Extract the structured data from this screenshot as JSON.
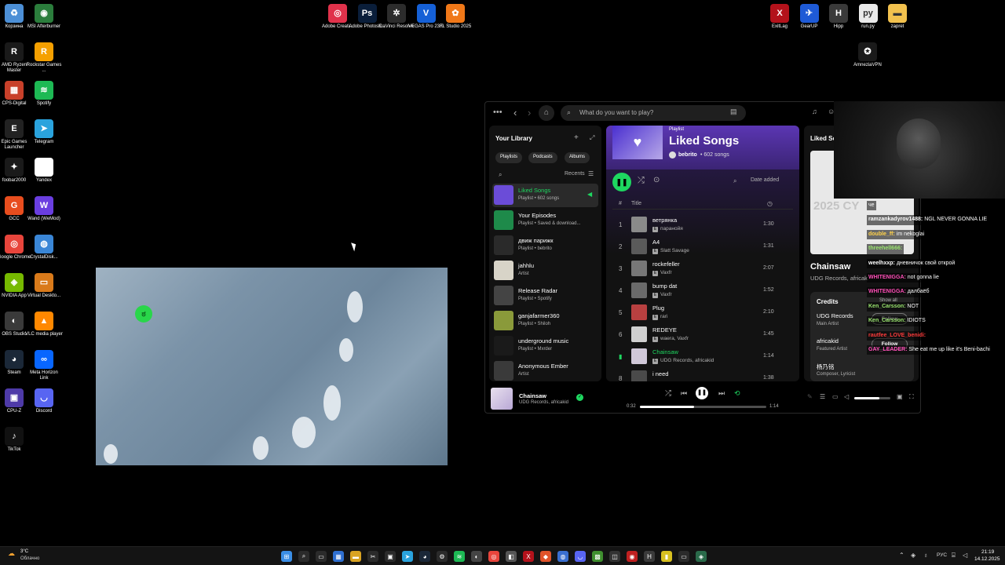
{
  "desktop": {
    "icons_left": [
      {
        "label": "Корзина",
        "icon": "recycle-bin-icon",
        "color": "#4c8fd6",
        "glyph": "♻"
      },
      {
        "label": "MSI Afterburner",
        "icon": "msi-afterburner-icon",
        "color": "#2b7d3c",
        "glyph": "◉"
      },
      {
        "label": "AMD Ryzen Master",
        "icon": "amd-ryzen-icon",
        "color": "#1a1a1a",
        "glyph": "R"
      },
      {
        "label": "Rockstar Games ...",
        "icon": "rockstar-icon",
        "color": "#f5a000",
        "glyph": "R"
      },
      {
        "label": "CPS-Digital",
        "icon": "cps-digital-icon",
        "color": "#c8402a",
        "glyph": "▦"
      },
      {
        "label": "Spotify",
        "icon": "spotify-icon",
        "color": "#1db954",
        "glyph": "≋"
      },
      {
        "label": "Epic Games Launcher",
        "icon": "epic-games-icon",
        "color": "#222222",
        "glyph": "E"
      },
      {
        "label": "Telegram",
        "icon": "telegram-icon",
        "color": "#2aa3dd",
        "glyph": "➤"
      },
      {
        "label": "foobar2000",
        "icon": "foobar-icon",
        "color": "#1a1a1a",
        "glyph": "✦"
      },
      {
        "label": "Yandex",
        "icon": "yandex-icon",
        "color": "#ffffff",
        "glyph": "Y"
      },
      {
        "label": "GCC",
        "icon": "gcc-icon",
        "color": "#e84d1e",
        "glyph": "G"
      },
      {
        "label": "Wand (WeMod)",
        "icon": "wand-icon",
        "color": "#6a3ee0",
        "glyph": "W"
      },
      {
        "label": "Google Chrome",
        "icon": "chrome-icon",
        "color": "#e8453c",
        "glyph": "◎"
      },
      {
        "label": "CrystalDisk...",
        "icon": "crystaldisk-icon",
        "color": "#3a86d6",
        "glyph": "◍"
      },
      {
        "label": "NVIDIA App",
        "icon": "nvidia-icon",
        "color": "#76b900",
        "glyph": "◈"
      },
      {
        "label": "Virtual Deskto...",
        "icon": "virtual-desktop-icon",
        "color": "#d97a1a",
        "glyph": "▭"
      },
      {
        "label": "OBS Studio",
        "icon": "obs-icon",
        "color": "#3a3a3a",
        "glyph": "◐"
      },
      {
        "label": "VLC media player",
        "icon": "vlc-icon",
        "color": "#ff8800",
        "glyph": "▲"
      },
      {
        "label": "Steam",
        "icon": "steam-icon",
        "color": "#1b2838",
        "glyph": "◕"
      },
      {
        "label": "Meta Horizon Link",
        "icon": "meta-icon",
        "color": "#0866ff",
        "glyph": "∞"
      },
      {
        "label": "CPU-Z",
        "icon": "cpuz-icon",
        "color": "#4e3aa8",
        "glyph": "▣"
      },
      {
        "label": "Discord",
        "icon": "discord-icon",
        "color": "#5865f2",
        "glyph": "◡"
      },
      {
        "label": "TikTok",
        "icon": "tiktok-icon",
        "color": "#111111",
        "glyph": "♪"
      }
    ],
    "icons_top": [
      {
        "label": "Adobe Creati...",
        "icon": "adobe-cc-icon",
        "color": "#e0324b",
        "glyph": "◎"
      },
      {
        "label": "Adobe Photosh...",
        "icon": "photoshop-icon",
        "color": "#0a1e3a",
        "glyph": "Ps"
      },
      {
        "label": "DaVinci Resolve",
        "icon": "davinci-icon",
        "color": "#2c2c2c",
        "glyph": "✲"
      },
      {
        "label": "VEGAS Pro 23.0",
        "icon": "vegas-icon",
        "color": "#1560d6",
        "glyph": "V"
      },
      {
        "label": "FL Studio 2025",
        "icon": "flstudio-icon",
        "color": "#f07818",
        "glyph": "✿"
      }
    ],
    "icons_right": [
      {
        "label": "ExitLag",
        "icon": "exitlag-icon",
        "color": "#b3121b",
        "glyph": "X"
      },
      {
        "label": "GearUP",
        "icon": "gearup-icon",
        "color": "#1e5ad6",
        "glyph": "✈"
      },
      {
        "label": "Hipp",
        "icon": "hipp-icon",
        "color": "#3a3a3a",
        "glyph": "H"
      },
      {
        "label": "run.py",
        "icon": "python-file-icon",
        "color": "#eaeaea",
        "glyph": "py"
      },
      {
        "label": "zapret",
        "icon": "folder-icon",
        "color": "#f2c14e",
        "glyph": "▬"
      },
      {
        "label": "AmneziaVPN",
        "icon": "amnezia-icon",
        "color": "#1a1a1a",
        "glyph": "✪"
      }
    ]
  },
  "spotify": {
    "search_placeholder": "What do you want to play?",
    "library": {
      "title": "Your Library",
      "chips": [
        "Playlists",
        "Podcasts",
        "Albums"
      ],
      "sort_label": "Recents",
      "items": [
        {
          "title": "Liked Songs",
          "subtitle": "Playlist • 602 songs",
          "color": "#6b4cd8",
          "active": true
        },
        {
          "title": "Your Episodes",
          "subtitle": "Playlist • Saved & download...",
          "color": "#1e8a4a",
          "active": false
        },
        {
          "title": "движ парижк",
          "subtitle": "Playlist • bebrito",
          "color": "#2a2a2a",
          "active": false
        },
        {
          "title": "jahhlu",
          "subtitle": "Artist",
          "color": "#d8d4c8",
          "active": false
        },
        {
          "title": "Release Radar",
          "subtitle": "Playlist • Spotify",
          "color": "#444444",
          "active": false
        },
        {
          "title": "ganjafarmer360",
          "subtitle": "Playlist • Shiloh",
          "color": "#8a9a3a",
          "active": false
        },
        {
          "title": "underground music",
          "subtitle": "Playlist • Mxrder",
          "color": "#1a1a1a",
          "active": false
        },
        {
          "title": "Anonymous Ember",
          "subtitle": "Artist",
          "color": "#3a3a3a",
          "active": false
        }
      ]
    },
    "playlist": {
      "type_label": "Playlist",
      "title": "Liked Songs",
      "owner": "bebrito",
      "song_count": "• 602 songs",
      "sort_label": "Date added",
      "col_number": "#",
      "col_title": "Title",
      "tracks": [
        {
          "num": "1",
          "title": "ветрянка",
          "artist": "паранойя",
          "duration": "1:30",
          "color": "#8a8a8a",
          "playing": false
        },
        {
          "num": "2",
          "title": "A4",
          "artist": "Slatt Savage",
          "duration": "1:31",
          "color": "#5a5a5a",
          "playing": false
        },
        {
          "num": "3",
          "title": "rockefeller",
          "artist": "Vaxfr",
          "duration": "2:07",
          "color": "#777777",
          "playing": false
        },
        {
          "num": "4",
          "title": "bump dat",
          "artist": "Vaxfr",
          "duration": "1:52",
          "color": "#6a6a6a",
          "playing": false
        },
        {
          "num": "5",
          "title": "Plug",
          "artist": "rari",
          "duration": "2:10",
          "color": "#b84040",
          "playing": false
        },
        {
          "num": "6",
          "title": "REDEYE",
          "artist": "waera, Vaxfr",
          "duration": "1:45",
          "color": "#cfcfcf",
          "playing": false
        },
        {
          "num": "",
          "title": "Chainsaw",
          "artist": "UDG Records, africakid",
          "duration": "1:14",
          "color": "#d0c8d8",
          "playing": true
        },
        {
          "num": "8",
          "title": "i need",
          "artist": "",
          "duration": "1:38",
          "color": "#4a4a4a",
          "playing": false
        }
      ]
    },
    "now_playing_panel": {
      "header": "Liked So",
      "cover_text": "2025 CY",
      "track_title": "Chainsaw",
      "track_artists": "UDG Records, africak",
      "credits_title": "Credits",
      "show_all": "Show all",
      "credits": [
        {
          "name": "UDG Records",
          "role": "Main Artist",
          "button": "Follow"
        },
        {
          "name": "africakid",
          "role": "Featured Artist",
          "button": "Follow"
        },
        {
          "name": "杨乃铭",
          "role": "Composer, Lyricist",
          "button": ""
        }
      ]
    },
    "player": {
      "title": "Chainsaw",
      "artists": "UDG Records, africakid",
      "elapsed": "0:32",
      "duration": "1:14",
      "progress": 0.43,
      "volume": 0.7
    },
    "accent": "#1ed760"
  },
  "stream_chat": [
    {
      "user": "",
      "message": "че",
      "color": "#ffffff"
    },
    {
      "user": "ramzankadyrov1488:",
      "message": "NGL NEVER GONNA LIE",
      "color": "#ffffff"
    },
    {
      "user": "double_ff:",
      "message": "im nekoglai",
      "color": "#ffd24a"
    },
    {
      "user": "threehell666:",
      "message": "",
      "color": "#9ae66e"
    },
    {
      "user": "weelhxxp:",
      "message": "дневничок свой открой",
      "color": "#ffffff"
    },
    {
      "user": "WHITENIGGA:",
      "message": "not gonna lie",
      "color": "#ff4fb8"
    },
    {
      "user": "WHITENIGGA:",
      "message": "далбаёб",
      "color": "#ff4fb8"
    },
    {
      "user": "Ken_Carsson:",
      "message": "NOT",
      "color": "#9ae66e"
    },
    {
      "user": "Ken_Carsson:",
      "message": "IDIOTS",
      "color": "#9ae66e"
    },
    {
      "user": "rautfee_LOVE_benidi:",
      "message": "",
      "color": "#ff3b3b"
    },
    {
      "user": "GAY_LEADER:",
      "message": "She eat me up like it's Beni-bachi",
      "color": "#ff4fb8"
    }
  ],
  "taskbar": {
    "weather_temp": "3°C",
    "weather_desc": "Облачно",
    "language": "РУС",
    "time": "21:19",
    "date": "14.12.2025"
  }
}
